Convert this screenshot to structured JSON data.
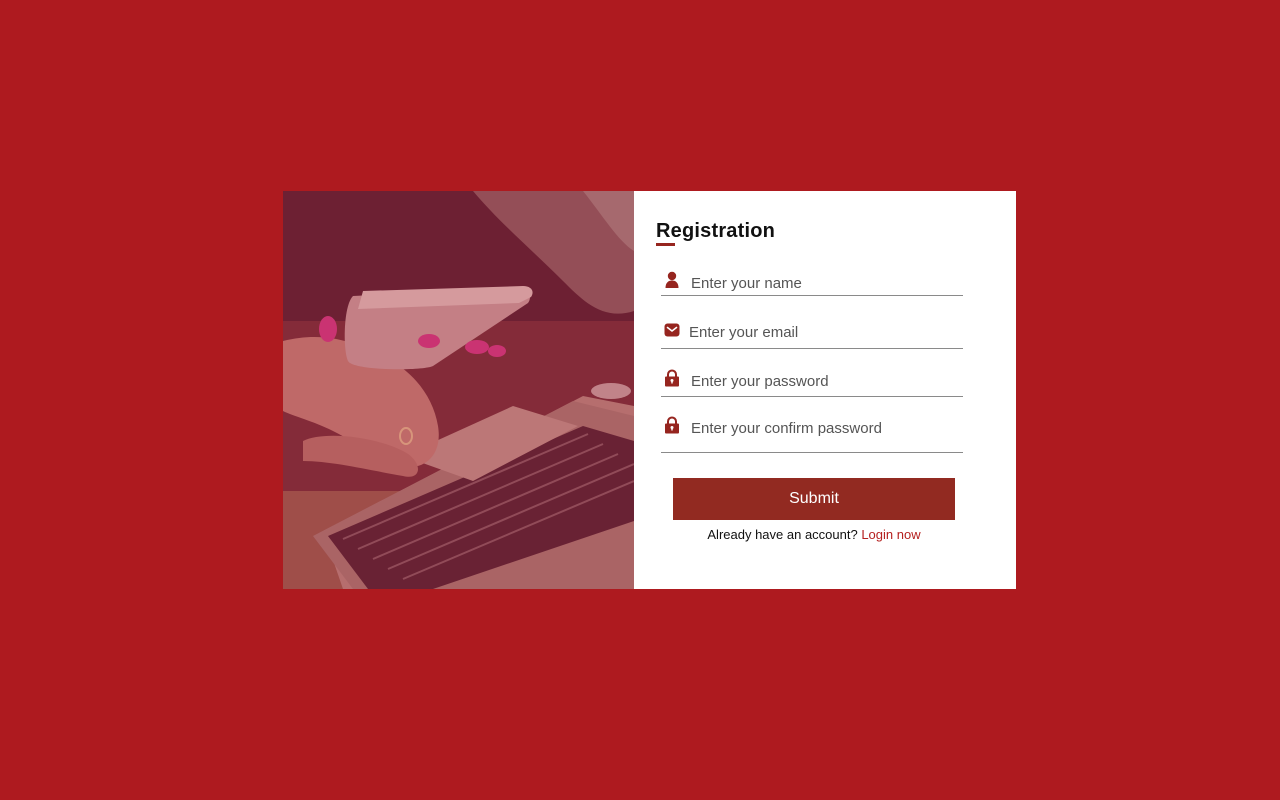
{
  "page": {
    "background_color": "#ae1a1f",
    "accent_color": "#922a21"
  },
  "hero_image": {
    "icon": "phone-and-laptop-photo"
  },
  "form": {
    "title": "Registration",
    "fields": [
      {
        "icon": "user-icon",
        "placeholder": "Enter your name",
        "value": ""
      },
      {
        "icon": "envelope-icon",
        "placeholder": "Enter your email",
        "value": ""
      },
      {
        "icon": "lock-icon",
        "placeholder": "Enter your password",
        "value": ""
      },
      {
        "icon": "lock-icon",
        "placeholder": "Enter your confirm password",
        "value": ""
      }
    ],
    "submit_label": "Submit",
    "login_prompt": "Already have an account?",
    "login_link": "Login now"
  }
}
